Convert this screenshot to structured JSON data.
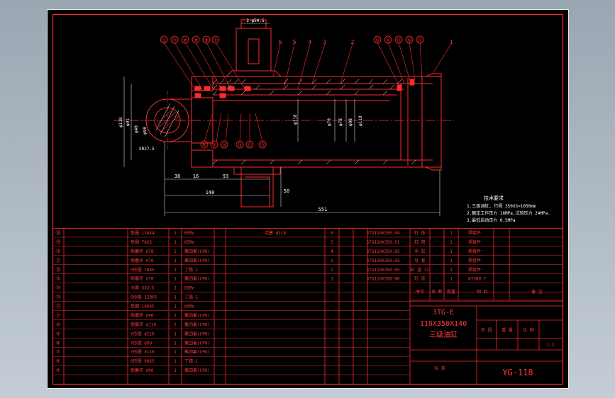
{
  "colors": {
    "paper": "#000000",
    "outer_border": "#ffffff",
    "ink": "#ff2a2a",
    "dim": "#d9d9d9",
    "hatch": "#ffffff"
  },
  "drawing": {
    "balloons_top_left": [
      "⑫",
      "⑪",
      "⑩",
      "⑨",
      "⑧",
      "⑦"
    ],
    "balloons_top_right": [
      "⑬",
      "⑭",
      "⑮",
      "⑯",
      "⑰"
    ],
    "balloons_bottom": [
      "⑥",
      "⑤",
      "⑭",
      "⑬",
      "⑫",
      "⑪"
    ],
    "part_numbers_top": [
      "6",
      "5",
      "4",
      "3",
      "2",
      "1"
    ],
    "port_label": "2-φ50.5",
    "dim_labels": [
      "38",
      "16",
      "93",
      "140",
      "50",
      "551"
    ],
    "vertical_dims": [
      "φ118",
      "φ91",
      "φ70",
      "φ78",
      "φ98",
      "φ110",
      "φ118"
    ],
    "eye_label": "SR27.5",
    "eye_dims": [
      "φ40",
      "φ90"
    ],
    "tech_title": "技术要求",
    "tech_notes": [
      "1.三级油缸, 行程 350X3=1050mm",
      "2.额定工作压力 16MPa,试验压力 24MPa.",
      "3.最低启动压力 0.5MPa"
    ]
  },
  "bom": {
    "left_rows": [
      {
        "no": "⑳",
        "name": "垫圈 114X4",
        "qty": "1",
        "material": "65Mn",
        "note": ""
      },
      {
        "no": "⑲",
        "name": "垫圈 78X5",
        "qty": "1",
        "material": "65Mn",
        "note": ""
      },
      {
        "no": "⑱",
        "name": "耐磨环 d78",
        "qty": "2",
        "material": "聚四氟(CPU)",
        "note": ""
      },
      {
        "no": "⑰",
        "name": "耐磨环 d70",
        "qty": "1",
        "material": "聚四氟(CPU)",
        "note": ""
      },
      {
        "no": "⑯",
        "name": "O形圈 78X5",
        "qty": "1",
        "material": "丁腈-1",
        "note": ""
      },
      {
        "no": "⑮",
        "name": "耐磨环 d70",
        "qty": "1",
        "material": "聚四氟(CPU)",
        "note": ""
      },
      {
        "no": "⑭",
        "name": "卡簧 3X3.5",
        "qty": "1",
        "material": "65Mn",
        "note": ""
      },
      {
        "no": "⑬",
        "name": "O形圈 120X5",
        "qty": "1",
        "material": "丁腈-1",
        "note": ""
      },
      {
        "no": "⑫",
        "name": "垫圈 100X5",
        "qty": "1",
        "material": "65Mn",
        "note": ""
      },
      {
        "no": "⑪",
        "name": "耐磨环 d90",
        "qty": "2",
        "material": "聚四氟(CPU)",
        "note": ""
      },
      {
        "no": "⑩",
        "name": "耐磨环 d110",
        "qty": "2",
        "material": "聚四氟(CPU)",
        "note": ""
      },
      {
        "no": "⑨",
        "name": "Y形圈 d110",
        "qty": "1",
        "material": "聚四氟(CPU)",
        "note": ""
      },
      {
        "no": "⑧",
        "name": "Y形圈 d90",
        "qty": "1",
        "material": "聚四氟(CPU)",
        "note": ""
      },
      {
        "no": "⑦",
        "name": "Y形圈 d110",
        "qty": "1",
        "material": "聚四氟(CPU)",
        "note": ""
      },
      {
        "no": "⑥",
        "name": "O形圈 98X5",
        "qty": "1",
        "material": "丁腈-1",
        "note": ""
      },
      {
        "no": "⑤",
        "name": "耐磨环 d90",
        "qty": "1",
        "material": "聚四氟(CPU)",
        "note": ""
      }
    ],
    "mid_rows": [
      {
        "name": "活塞 d118",
        "no": "6",
        "code": "3TG110X350.04"
      },
      {
        "name": "",
        "no": "5",
        "code": "3TG110X350.01"
      },
      {
        "name": "",
        "no": "4",
        "code": "3TG110X350.02"
      },
      {
        "name": "",
        "no": "3",
        "code": "3TG110X350.03"
      },
      {
        "name": "",
        "no": "2",
        "code": "3TG110X350.05"
      },
      {
        "name": "",
        "no": "1",
        "code": "3TG110X350-06"
      }
    ],
    "right_rows": [
      {
        "name": "缸 体",
        "qty": "1",
        "note": "焊接件"
      },
      {
        "name": "缸 筒",
        "qty": "1",
        "note": "焊接件"
      },
      {
        "name": "中 缸",
        "qty": "1",
        "note": "焊接件"
      },
      {
        "name": "导 套",
        "qty": "1",
        "note": "焊接件"
      },
      {
        "name": "缸 盖 II",
        "qty": "1",
        "note": "焊接件"
      },
      {
        "name": "缸 底",
        "qty": "1",
        "note": "QT500-7"
      }
    ],
    "header_right": [
      "序号",
      "名 称",
      "数量",
      "材 料",
      "备 注"
    ],
    "title_block": {
      "title_lines": [
        "3TG-E",
        "110X350X140",
        "三级油缸"
      ],
      "stage_label": "阶 段",
      "weight_label": "重 量",
      "scale_label": "比 例",
      "scale_value": "1:2",
      "drawing_no": "YG-118",
      "sign_rows": [
        "设计",
        "校对",
        "审核",
        "工艺",
        "批准"
      ],
      "bottom_label": "标 准"
    }
  }
}
